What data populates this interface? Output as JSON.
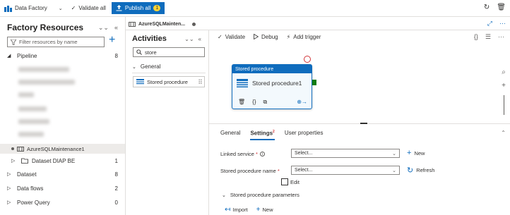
{
  "topbar": {
    "product": "Data Factory",
    "validate_all": "Validate all",
    "publish_all": "Publish all",
    "publish_count": "1"
  },
  "left": {
    "title": "Factory Resources",
    "filter_placeholder": "Filter resources by name",
    "pipeline": {
      "label": "Pipeline",
      "count": "8"
    },
    "selected_pipeline": "AzureSQLMaintenance1",
    "dataset_folder": {
      "label": "Dataset DIAP BE",
      "count": "1"
    },
    "dataset": {
      "label": "Dataset",
      "count": "8"
    },
    "dataflows": {
      "label": "Data flows",
      "count": "2"
    },
    "powerquery": {
      "label": "Power Query",
      "count": "0"
    }
  },
  "tab": {
    "label": "AzureSQLMainten..."
  },
  "activities": {
    "title": "Activities",
    "search_value": "store",
    "group": "General",
    "item": "Stored procedure"
  },
  "toolbar": {
    "validate": "Validate",
    "debug": "Debug",
    "add_trigger": "Add trigger"
  },
  "node": {
    "header": "Stored procedure",
    "name": "Stored procedure1"
  },
  "props": {
    "tabs": [
      "General",
      "Settings",
      "User properties"
    ],
    "settings_badge": "2",
    "linked_service_label": "Linked service",
    "linked_service_value": "Select...",
    "new_label": "New",
    "sp_name_label": "Stored procedure name",
    "sp_name_value": "Select...",
    "refresh_label": "Refresh",
    "edit_label": "Edit",
    "sp_params_label": "Stored procedure parameters",
    "import_label": "Import",
    "new2_label": "New"
  }
}
